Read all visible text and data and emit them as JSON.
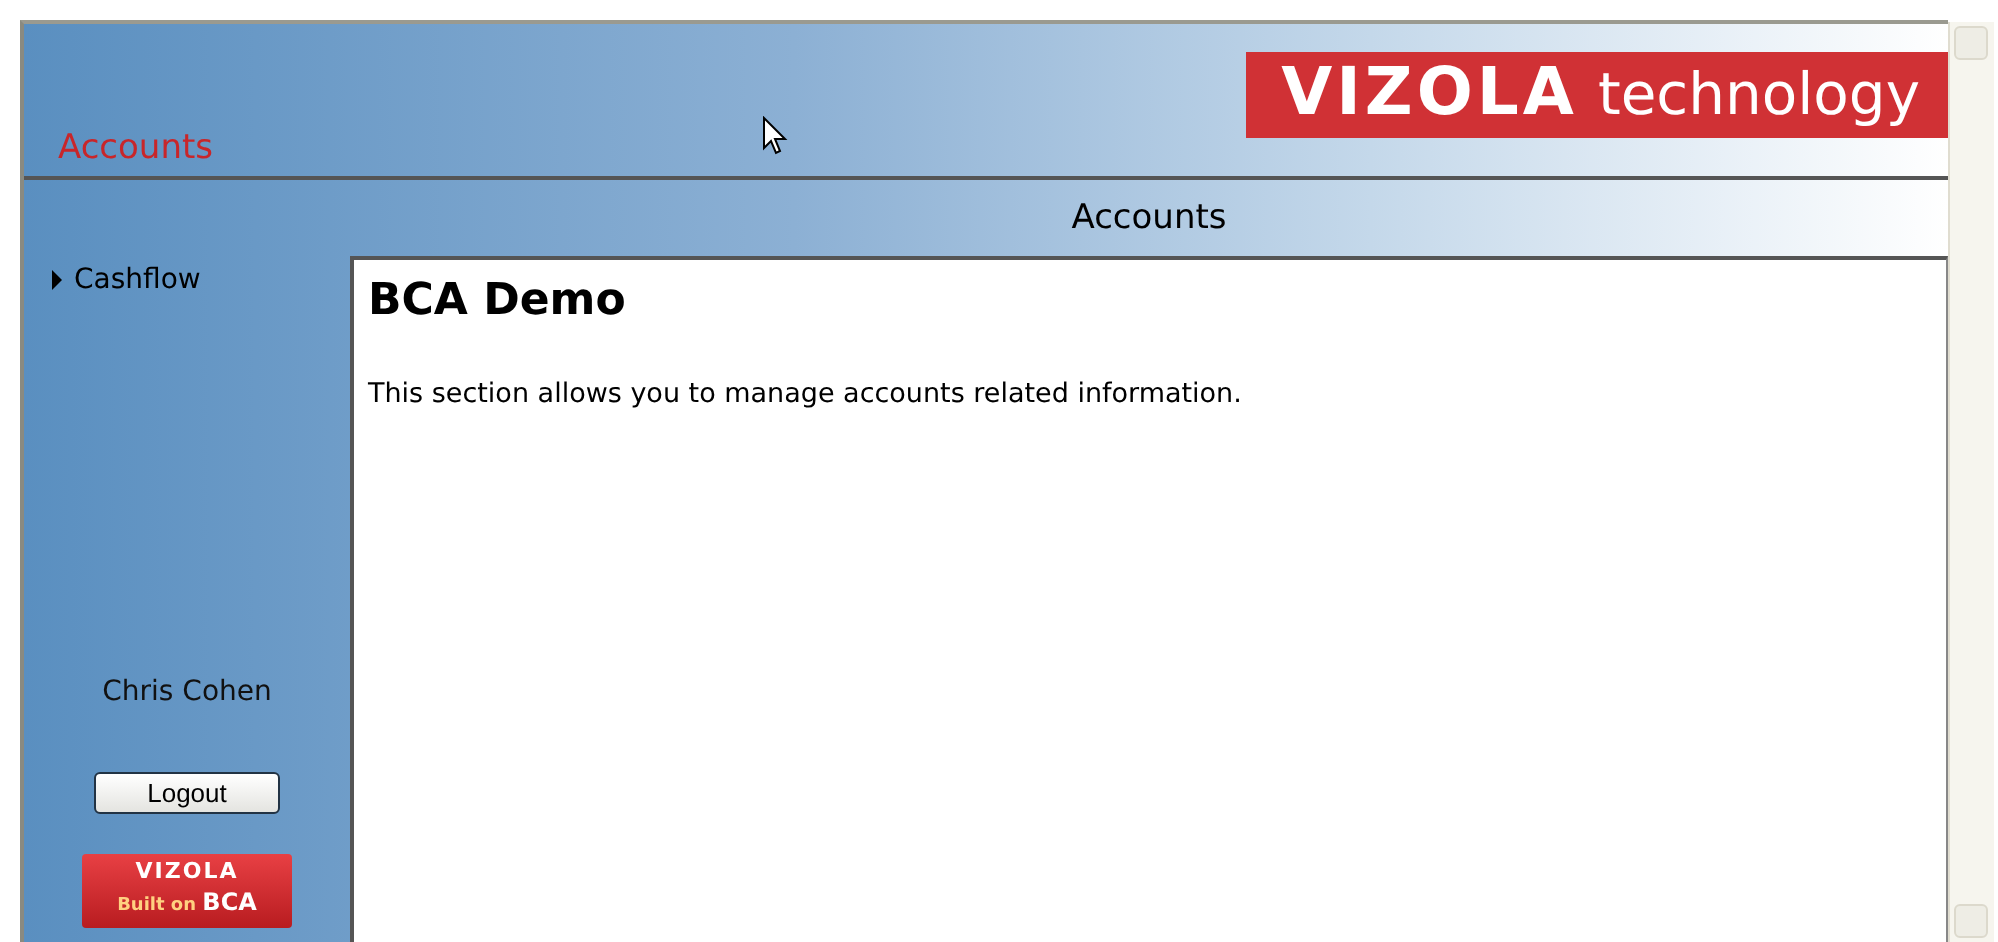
{
  "header": {
    "section_title": "Accounts",
    "logo": {
      "brand": "VIZOLA",
      "tagline": "technology"
    }
  },
  "page_heading": "Accounts",
  "sidebar": {
    "items": [
      {
        "label": "Cashflow",
        "selected": false
      }
    ],
    "user_name": "Chris Cohen",
    "logout_button": "Logout",
    "badge": {
      "brand": "VIZOLA",
      "prefix": "Built on",
      "product": "BCA"
    }
  },
  "content": {
    "title": "BCA Demo",
    "description": "This section allows you to manage accounts related information."
  }
}
